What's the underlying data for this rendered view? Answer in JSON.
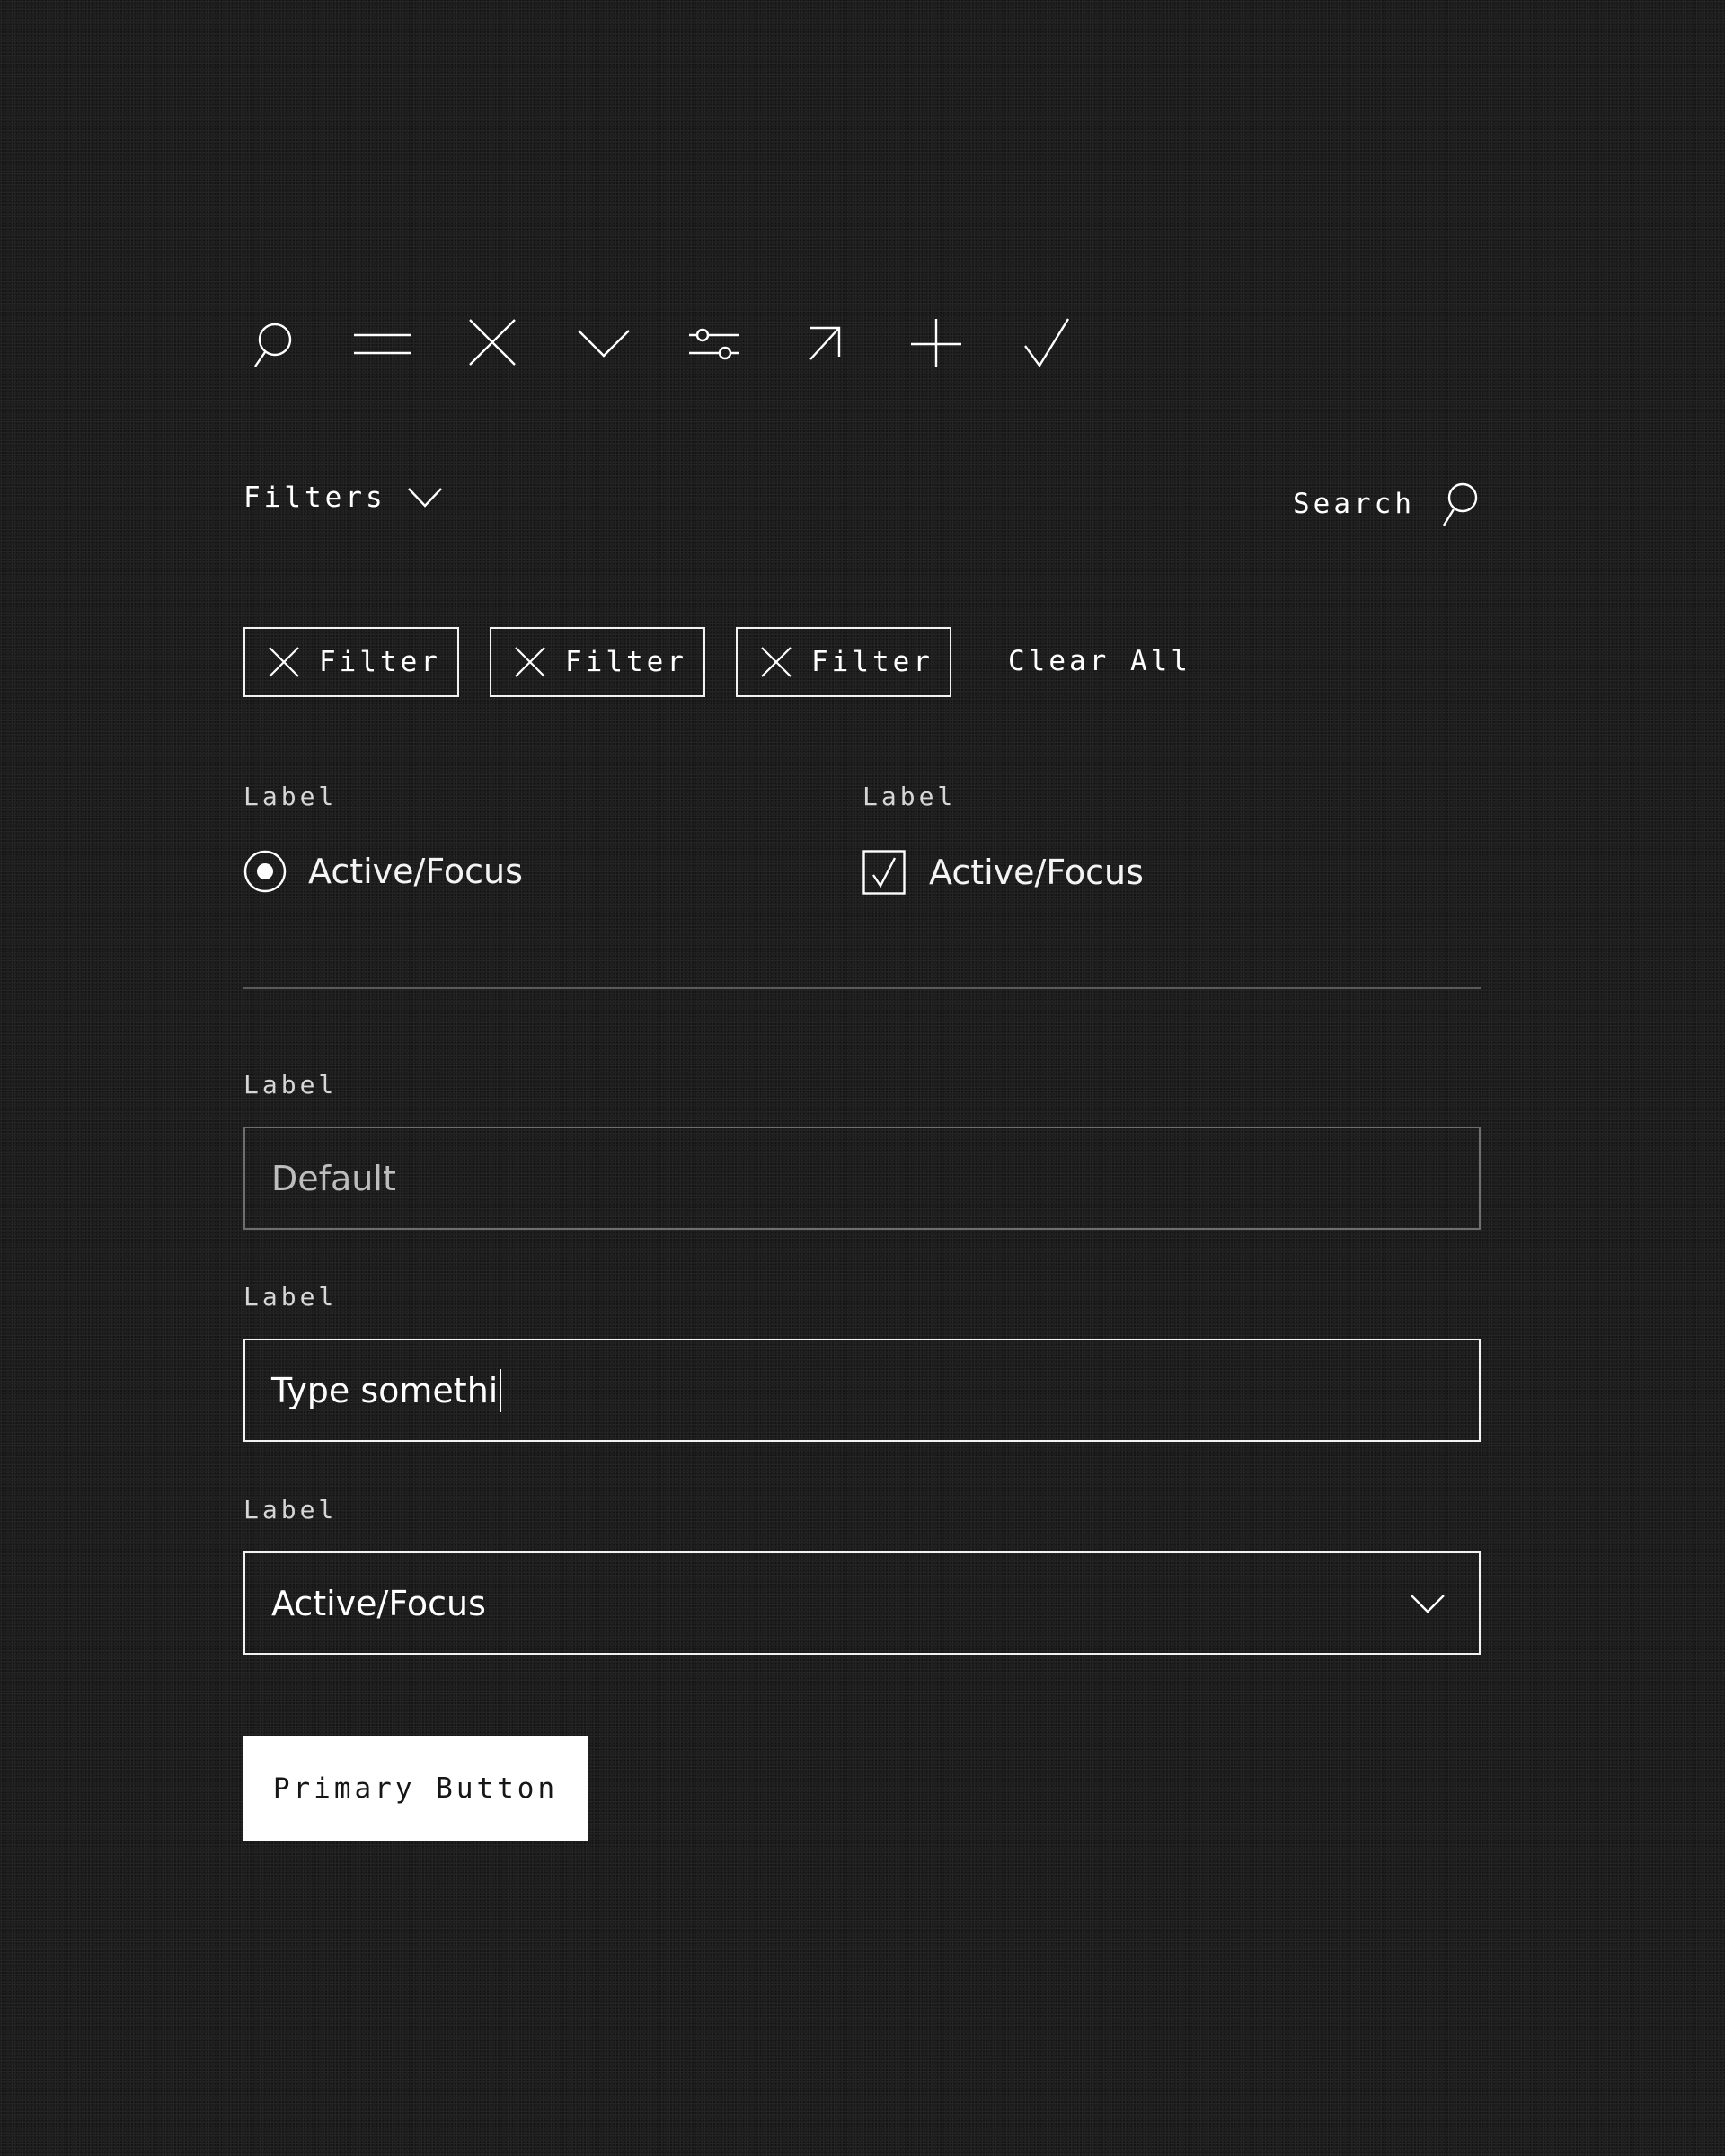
{
  "icon_row": [
    {
      "name": "search-icon"
    },
    {
      "name": "menu-icon"
    },
    {
      "name": "close-icon"
    },
    {
      "name": "chevron-down-icon"
    },
    {
      "name": "sliders-icon"
    },
    {
      "name": "arrow-up-right-icon"
    },
    {
      "name": "plus-icon"
    },
    {
      "name": "checkmark-icon"
    }
  ],
  "toolbar": {
    "filters_label": "Filters",
    "search_label": "Search"
  },
  "chips": [
    {
      "label": "Filter"
    },
    {
      "label": "Filter"
    },
    {
      "label": "Filter"
    }
  ],
  "clear_all_label": "Clear All",
  "radio_group": {
    "label": "Label",
    "option_label": "Active/Focus",
    "selected": true
  },
  "checkbox_group": {
    "label": "Label",
    "option_label": "Active/Focus",
    "checked": true
  },
  "fields": {
    "default": {
      "label": "Label",
      "placeholder": "Default"
    },
    "focused": {
      "label": "Label",
      "value": "Type somethi"
    },
    "select": {
      "label": "Label",
      "value": "Active/Focus"
    }
  },
  "primary_button_label": "Primary Button",
  "colors": {
    "background": "#1c1c1c",
    "foreground": "#ffffff",
    "muted_border": "#6e6e6e"
  }
}
